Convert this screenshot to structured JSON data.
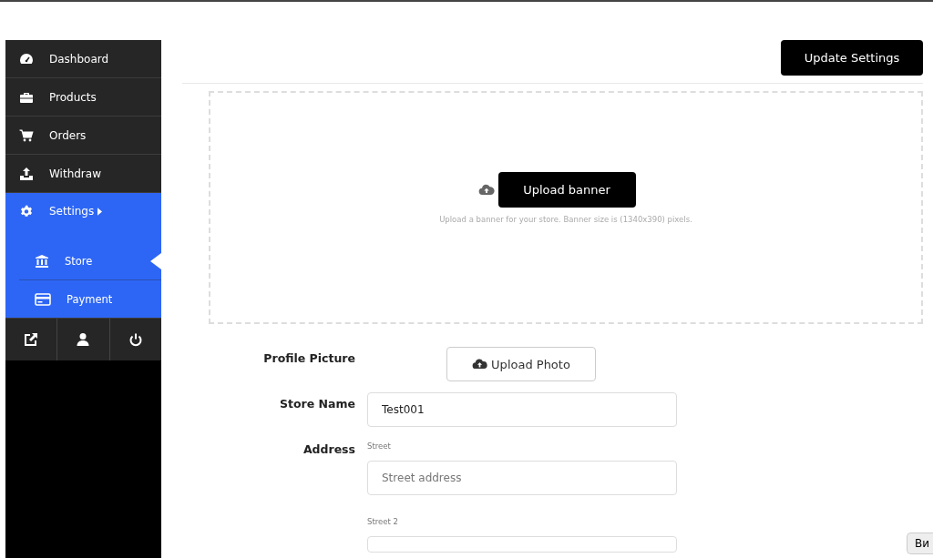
{
  "sidebar": {
    "items": [
      {
        "label": "Dashboard",
        "selected": false
      },
      {
        "label": "Products",
        "selected": false
      },
      {
        "label": "Orders",
        "selected": false
      },
      {
        "label": "Withdraw",
        "selected": false
      },
      {
        "label": "Settings",
        "selected": true,
        "children": [
          {
            "label": "Store",
            "selected": true
          },
          {
            "label": "Payment",
            "selected": false
          }
        ]
      }
    ]
  },
  "header": {
    "button": "Update Settings"
  },
  "banner": {
    "button": "Upload banner",
    "hint": "Upload a banner for your store. Banner size is (1340x390) pixels."
  },
  "form": {
    "profile_picture": {
      "label": "Profile Picture",
      "button": "Upload Photo"
    },
    "store_name": {
      "label": "Store Name",
      "value": "Test001"
    },
    "address": {
      "label": "Address",
      "fields": [
        {
          "caption": "Street",
          "placeholder": "Street address"
        },
        {
          "caption": "Street 2"
        }
      ]
    }
  },
  "bottom_bar": {
    "button": "Ви"
  }
}
